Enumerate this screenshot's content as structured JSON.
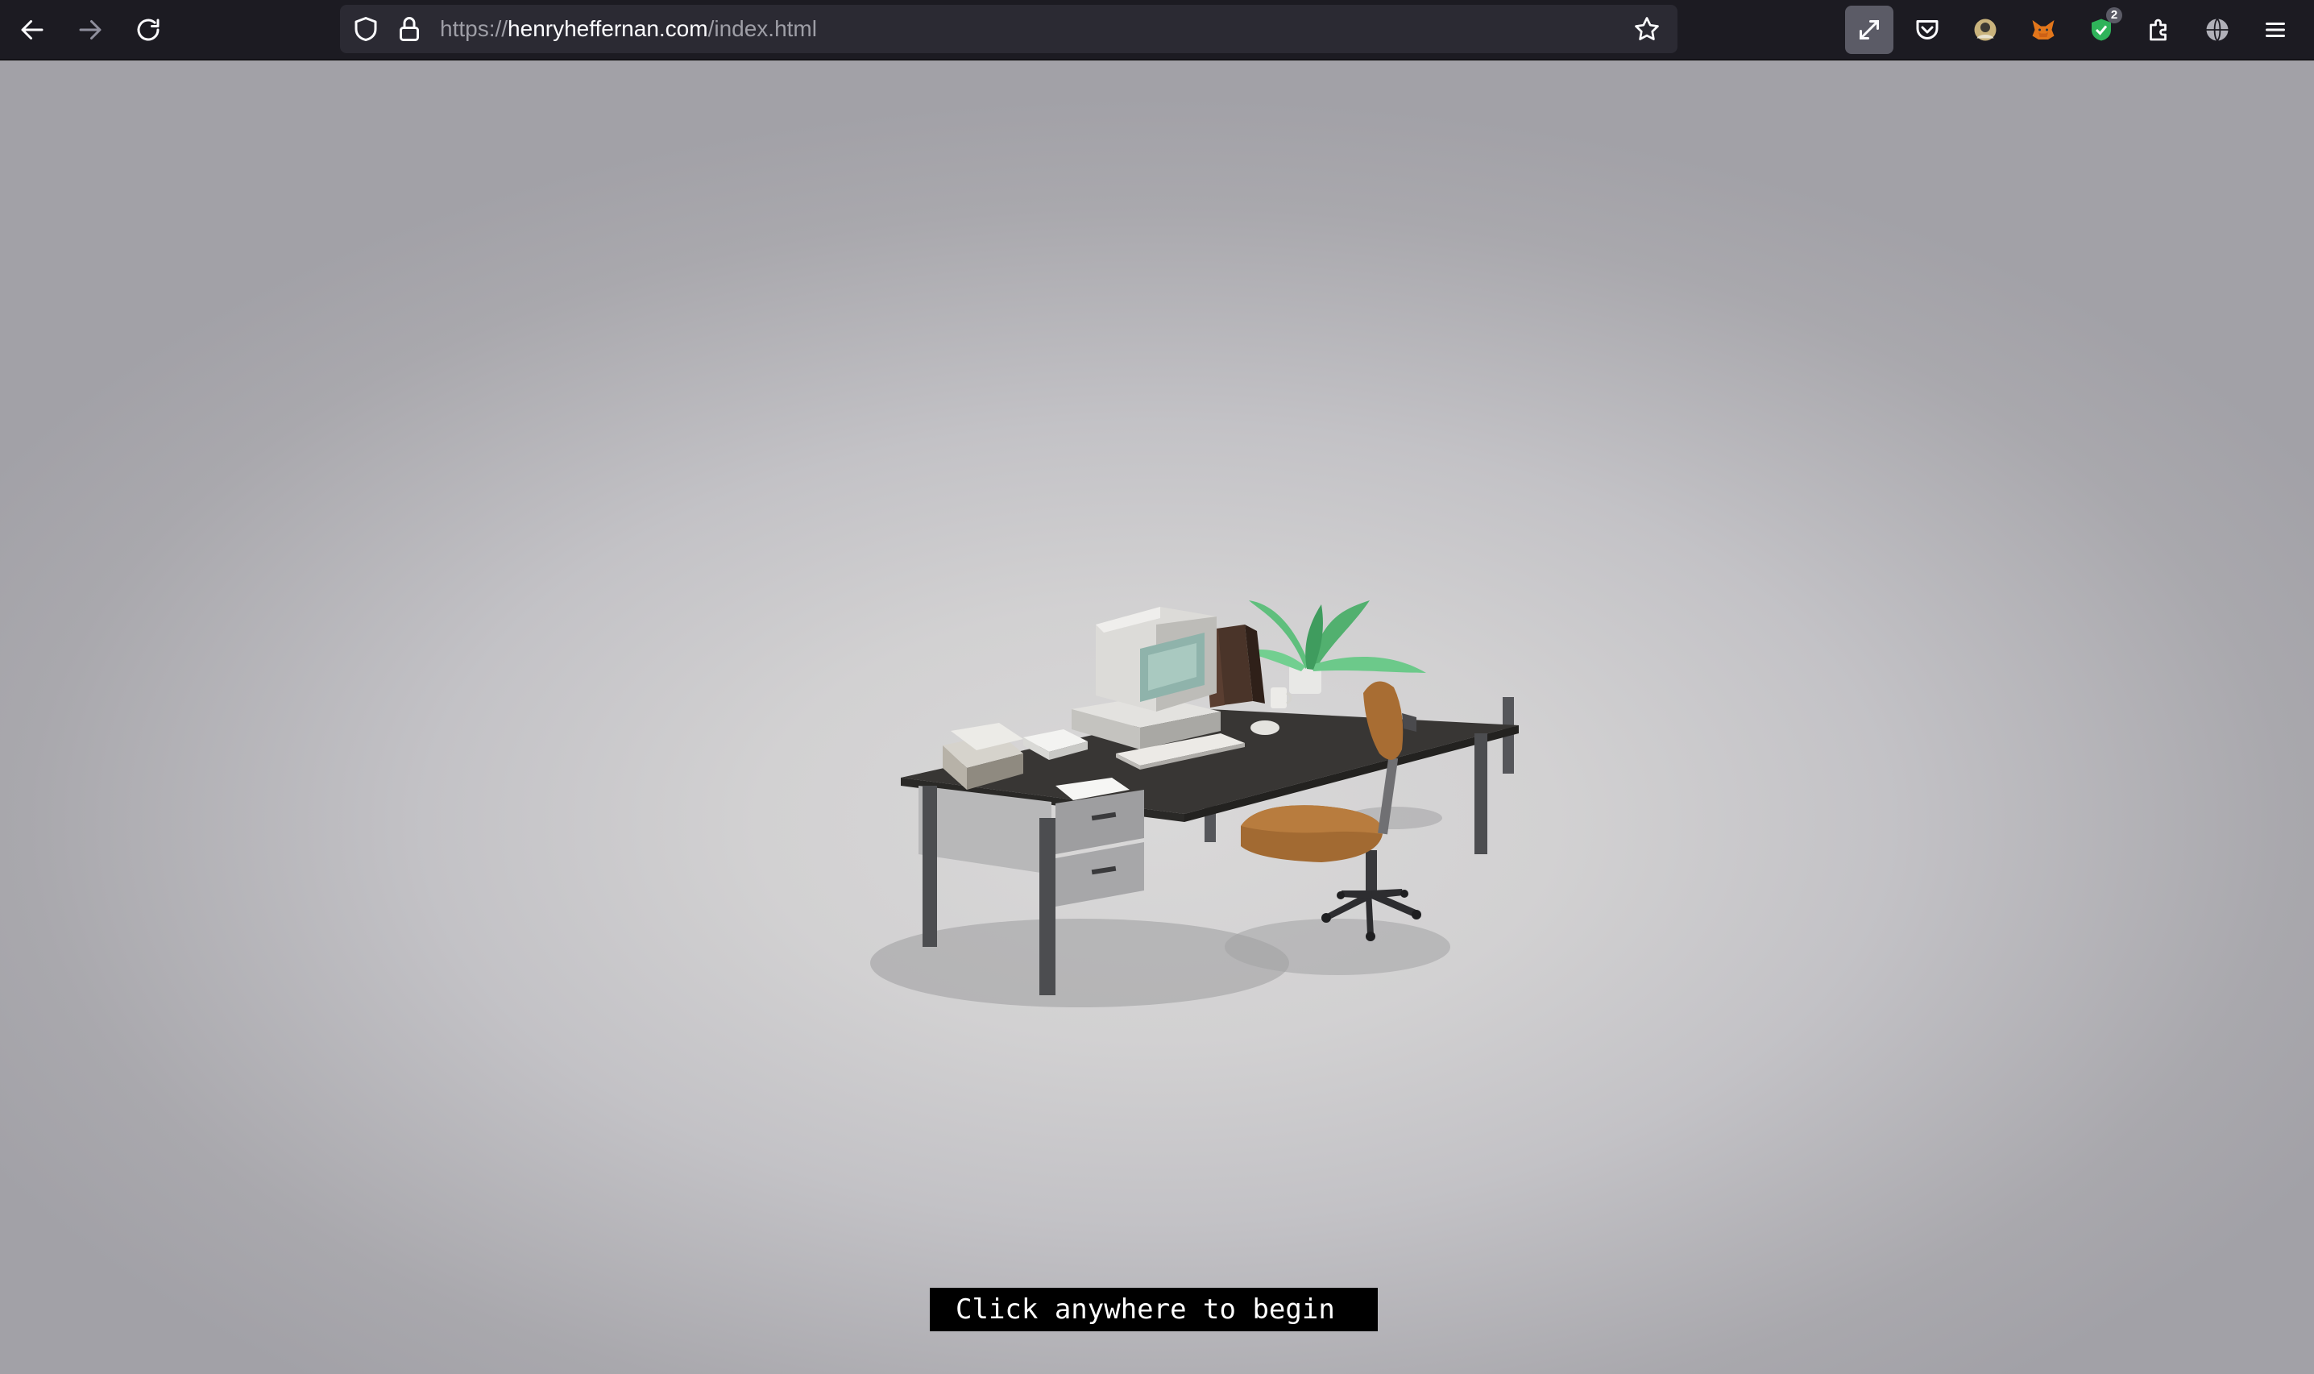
{
  "browser": {
    "nav": {
      "back_icon": "arrow-left-icon",
      "forward_icon": "arrow-right-icon",
      "reload_icon": "reload-icon"
    },
    "url": {
      "scheme": "https://",
      "host": "henryheffernan.com",
      "path": "/index.html",
      "shield_icon": "tracking-protection-shield-icon",
      "lock_icon": "lock-icon",
      "bookmark_icon": "star-icon"
    },
    "extensions": [
      {
        "name": "fullscreen-expand-icon",
        "active": true
      },
      {
        "name": "pocket-icon"
      },
      {
        "name": "extension-avatar-icon"
      },
      {
        "name": "metamask-fox-icon"
      },
      {
        "name": "shield-check-icon",
        "badge": "2"
      },
      {
        "name": "puzzle-extensions-icon"
      },
      {
        "name": "globe-icon"
      },
      {
        "name": "hamburger-menu-icon"
      }
    ]
  },
  "page": {
    "prompt": "Click anywhere to begin",
    "scene_description_icon": "office-desk-3d-scene",
    "colors": {
      "background_center": "#d9d8d8",
      "background_edge": "#a2a1a7",
      "prompt_bg": "#000000",
      "prompt_fg": "#ffffff",
      "toolbar_bg": "#1c1b22",
      "urlbar_bg": "#2b2a33"
    }
  }
}
